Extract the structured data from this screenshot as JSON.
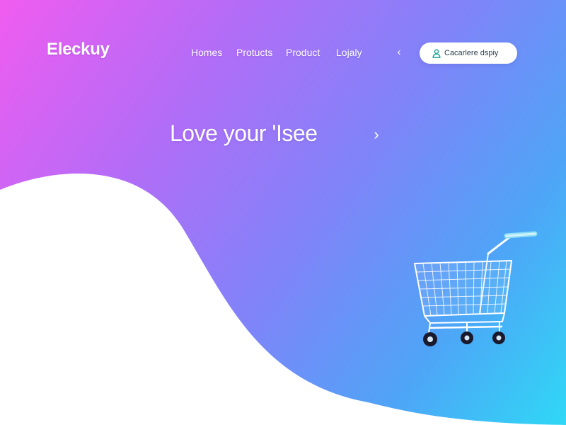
{
  "header": {
    "logo": "Eleckuy",
    "nav": [
      {
        "label": "Homes"
      },
      {
        "label": "Protucts"
      },
      {
        "label": "Product"
      },
      {
        "label": "Lojaly"
      }
    ],
    "prev_icon": "chevron-left-icon",
    "cta": {
      "label": "Cacarlere dspiy",
      "icon": "user-icon"
    }
  },
  "hero": {
    "headline": "Love your 'Isee",
    "next_icon": "chevron-right-icon",
    "illustration": "shopping-cart-icon"
  },
  "colors": {
    "gradient_magenta": "#f05cf0",
    "gradient_purple": "#b46cf7",
    "gradient_blue": "#4fa4f7",
    "gradient_cyan": "#2fd8f6",
    "button_bg": "#ffffff",
    "button_text": "#2c3e50",
    "icon_teal": "#2aa7a0"
  }
}
